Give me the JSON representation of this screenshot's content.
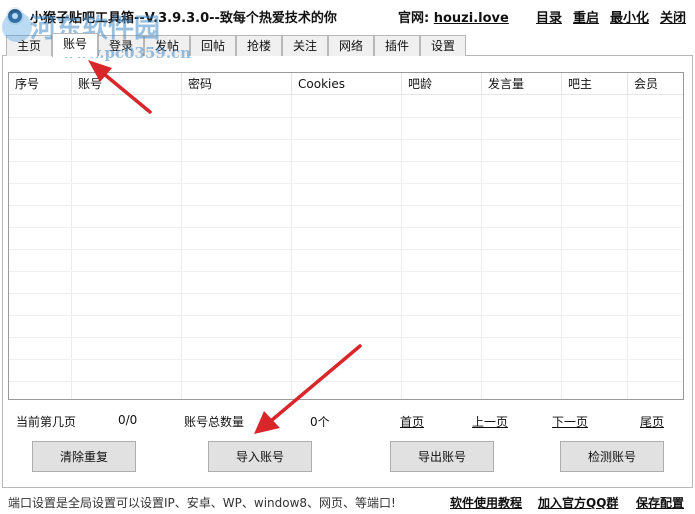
{
  "window": {
    "title": "小猴子贴吧工具箱--V.3.9.3.0--致每个热爱技术的你",
    "site_label": "官网:",
    "site_url": "houzi.love",
    "menu": [
      "目录",
      "重启",
      "最小化",
      "关闭"
    ]
  },
  "tabs": [
    "主页",
    "账号",
    "登录",
    "发帖",
    "回帖",
    "抢楼",
    "关注",
    "网络",
    "插件",
    "设置"
  ],
  "active_tab": 1,
  "table": {
    "columns": [
      "序号",
      "账号",
      "密码",
      "Cookies",
      "吧龄",
      "发言量",
      "吧主",
      "会员"
    ]
  },
  "pager": {
    "current_page_label": "当前第几页",
    "current_page_value": "0/0",
    "total_label": "账号总数量",
    "total_value": "0个",
    "first": "首页",
    "prev": "上一页",
    "next": "下一页",
    "last": "尾页"
  },
  "buttons": {
    "clear_duplicates": "清除重复",
    "import_accounts": "导入账号",
    "export_accounts": "导出账号",
    "check_accounts": "检测账号"
  },
  "status": {
    "text": "端口设置是全局设置可以设置IP、安卓、WP、window8、网页、等端口!",
    "links": [
      "软件使用教程",
      "加入官方QQ群",
      "保存配置"
    ]
  },
  "watermark": {
    "main": "河东软件园",
    "sub": "www.pc0359.cn"
  },
  "colors": {
    "annotation_arrow": "#d9262b",
    "watermark": "#468cc8"
  }
}
